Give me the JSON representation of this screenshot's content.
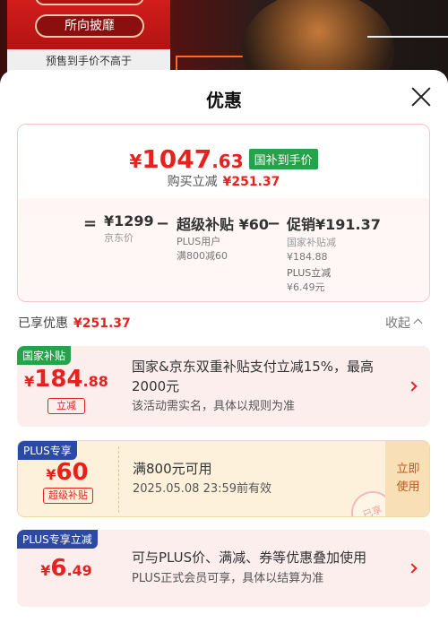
{
  "banner": {
    "button_label": "所向披靡",
    "presale_text": "预售到手价不高于"
  },
  "sheet": {
    "title": "优惠"
  },
  "price_card": {
    "final_currency": "¥",
    "final_int": "1047",
    "final_dec": ".63",
    "final_tag": "国补到手价",
    "buy_label": "购买立减",
    "buy_amount": "¥251.37",
    "equals": "=",
    "minus1": "−",
    "minus2": "−",
    "jd_price": "¥1299",
    "jd_price_label": "京东价",
    "super_subsidy": "超级补贴 ¥60",
    "super_sub1": "PLUS用户",
    "super_sub2": "满800减60",
    "promo": "促销¥191.37",
    "promo_sub1": "国家补贴减",
    "promo_sub1_amt": "¥184.88",
    "promo_sub2": "PLUS立减",
    "promo_sub2_amt": "¥6.49元"
  },
  "enjoyed": {
    "label": "已享优惠",
    "amount": "¥251.37",
    "collapse_label": "收起"
  },
  "coupons": [
    {
      "badge": "国家补贴",
      "currency": "¥",
      "int": "184",
      "dec": ".88",
      "subtag": "立减",
      "line1": "国家&京东双重补贴支付立减15%，最高",
      "line2": "2000元",
      "line3": "该活动需实名，具体以规则为准"
    },
    {
      "badge": "PLUS专享",
      "currency": "¥",
      "int": "60",
      "dec": "",
      "subtag": "超级补贴",
      "line1": "满800元可用",
      "line2": "2025.05.08 23:59前有效",
      "use_line1": "立即",
      "use_line2": "使用",
      "stamp": "已享"
    },
    {
      "badge": "PLUS专享立减",
      "currency": "¥",
      "int": "6",
      "dec": ".49",
      "line1": "可与PLUS价、满减、券等优惠叠加使用",
      "line2": "PLUS正式会员可享，具体以结算为准"
    }
  ],
  "colors": {
    "accent_red": "#e4231f",
    "subsidy_green": "#25a24a",
    "plus_blue": "#2c4aa5"
  }
}
